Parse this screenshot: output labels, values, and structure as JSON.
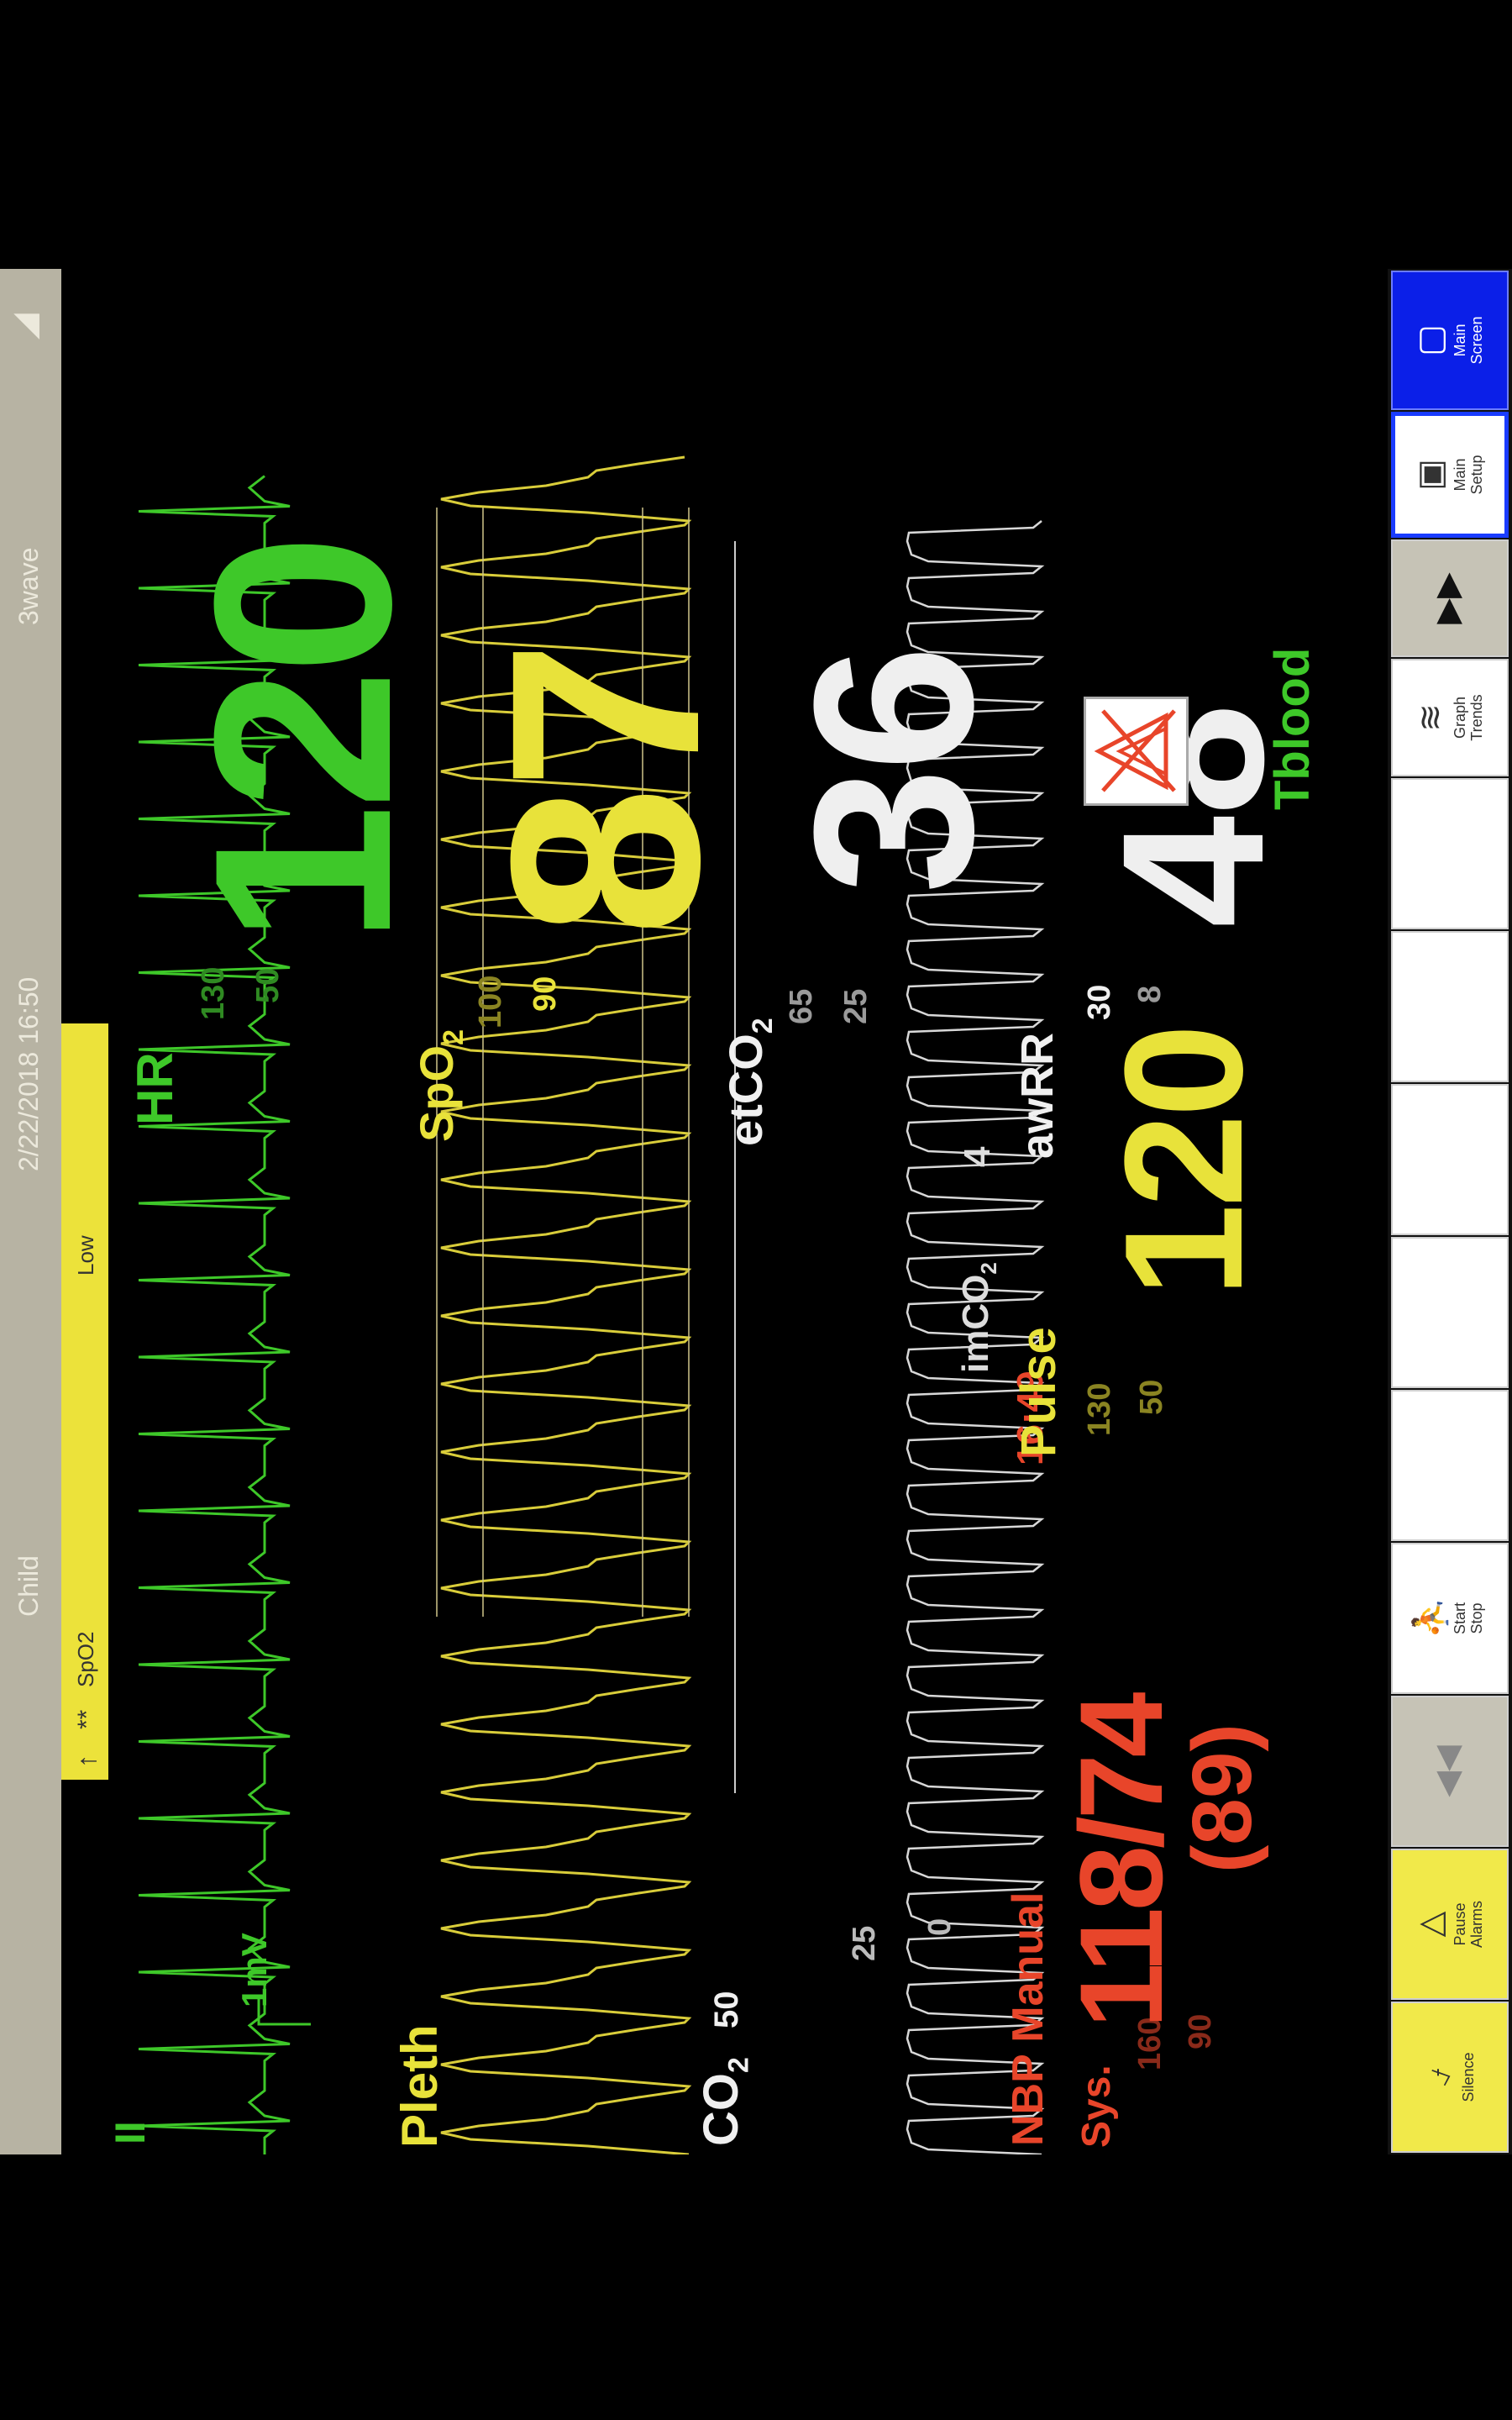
{
  "status_bar": {
    "patient_type": "Child",
    "datetime": "2/22/2018 16:50",
    "layout": "3wave"
  },
  "alarm": {
    "arrow": "↑",
    "level": "**",
    "source": "SpO2",
    "message": "Low"
  },
  "ecg": {
    "lead": "II",
    "scale": "1mV",
    "label": "HR",
    "limit_high": "130",
    "limit_low": "50",
    "value": "120",
    "color": "#3ec829"
  },
  "pleth": {
    "label": "Pleth"
  },
  "spo2": {
    "label": "SpO",
    "sub": "2",
    "limit_high": "100",
    "limit_low": "90",
    "value": "87",
    "color": "#e8e23a"
  },
  "co2": {
    "label": "CO",
    "sub": "2",
    "scale_50": "50",
    "scale_25": "25",
    "scale_0": "0"
  },
  "etco2": {
    "label": "etCO",
    "sub": "2",
    "limit_high": "65",
    "limit_low": "25",
    "value": "36",
    "imco2_label": "imCO",
    "imco2_sub": "2",
    "imco2_value": "4",
    "color": "#e8e8e8"
  },
  "awrr": {
    "label": "awRR",
    "limit_high": "30",
    "limit_low": "8",
    "value": "48"
  },
  "tblood": {
    "label": "Tblood",
    "alarm_off_icon": "alarm-off-icon"
  },
  "nbp": {
    "label": "NBP Manual",
    "time": "16:49",
    "sys_label": "Sys.",
    "sys_limit_high": "160",
    "sys_limit_low": "90",
    "value": "118/74",
    "mean": "(89)",
    "color": "#e8452a"
  },
  "pulse": {
    "label": "Pulse",
    "limit_high": "130",
    "limit_low": "50",
    "value": "120"
  },
  "softkeys": [
    {
      "label1": "Silence",
      "label2": "",
      "icon": "silence-icon"
    },
    {
      "label1": "Pause",
      "label2": "Alarms",
      "icon": "pause-alarms-icon"
    },
    {
      "label1": "",
      "label2": "",
      "icon": "page-back-icon"
    },
    {
      "label1": "Start",
      "label2": "Stop",
      "icon": "start-stop-icon"
    },
    {
      "label1": "Graph",
      "label2": "Trends",
      "icon": "graph-trends-icon"
    },
    {
      "label1": "",
      "label2": "",
      "icon": "page-forward-icon"
    },
    {
      "label1": "Main",
      "label2": "Setup",
      "icon": "main-setup-icon"
    },
    {
      "label1": "Main",
      "label2": "Screen",
      "icon": "main-screen-icon"
    }
  ]
}
